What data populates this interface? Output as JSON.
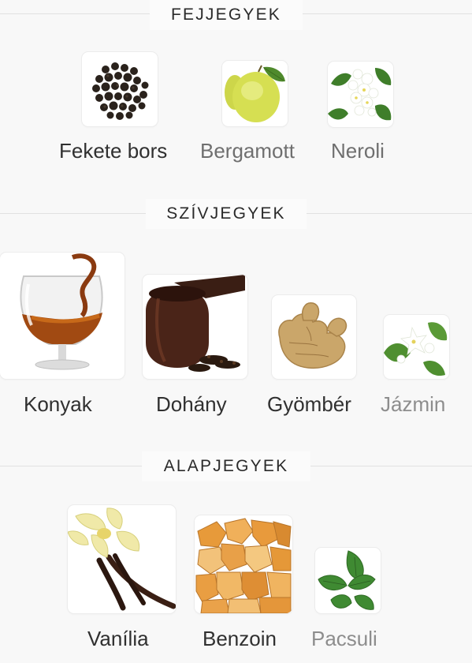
{
  "sections": [
    {
      "title": "FEJJEGYEK",
      "notes": [
        {
          "name": "Fekete bors",
          "icon": "black-pepper-image"
        },
        {
          "name": "Bergamott",
          "icon": "bergamot-image"
        },
        {
          "name": "Neroli",
          "icon": "neroli-image"
        }
      ]
    },
    {
      "title": "SZÍVJEGYEK",
      "notes": [
        {
          "name": "Konyak",
          "icon": "cognac-image"
        },
        {
          "name": "Dohány",
          "icon": "tobacco-pipe-image"
        },
        {
          "name": "Gyömbér",
          "icon": "ginger-image"
        },
        {
          "name": "Jázmin",
          "icon": "jasmine-image"
        }
      ]
    },
    {
      "title": "ALAPJEGYEK",
      "notes": [
        {
          "name": "Vanília",
          "icon": "vanilla-image"
        },
        {
          "name": "Benzoin",
          "icon": "benzoin-image"
        },
        {
          "name": "Pacsuli",
          "icon": "patchouli-image"
        }
      ]
    }
  ]
}
